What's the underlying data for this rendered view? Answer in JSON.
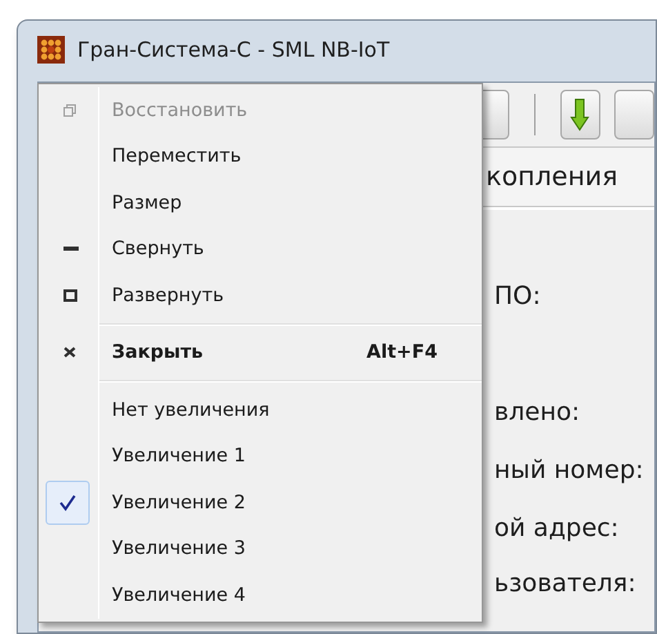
{
  "window": {
    "title": "Гран-Система-С - SML NB-IoT"
  },
  "background": {
    "tab_label": "копления",
    "labels": [
      "ПО:",
      "влено:",
      "ный номер:",
      "ой адрес:",
      "ьзователя:"
    ]
  },
  "system_menu": {
    "items": [
      {
        "kind": "restore",
        "label": "Восстановить",
        "disabled": true
      },
      {
        "kind": "plain",
        "label": "Переместить",
        "disabled": false
      },
      {
        "kind": "plain",
        "label": "Размер",
        "disabled": false
      },
      {
        "kind": "minimize",
        "label": "Свернуть",
        "disabled": false
      },
      {
        "kind": "maximize",
        "label": "Развернуть",
        "disabled": false
      },
      {
        "kind": "separator"
      },
      {
        "kind": "close",
        "label": "Закрыть",
        "shortcut": "Alt+F4",
        "disabled": false
      },
      {
        "kind": "separator"
      },
      {
        "kind": "plain",
        "label": "Нет увеличения",
        "disabled": false,
        "checked": false
      },
      {
        "kind": "plain",
        "label": "Увеличение 1",
        "disabled": false,
        "checked": false
      },
      {
        "kind": "plain",
        "label": "Увеличение 2",
        "disabled": false,
        "checked": true
      },
      {
        "kind": "plain",
        "label": "Увеличение 3",
        "disabled": false,
        "checked": false
      },
      {
        "kind": "plain",
        "label": "Увеличение 4",
        "disabled": false,
        "checked": false
      }
    ]
  }
}
